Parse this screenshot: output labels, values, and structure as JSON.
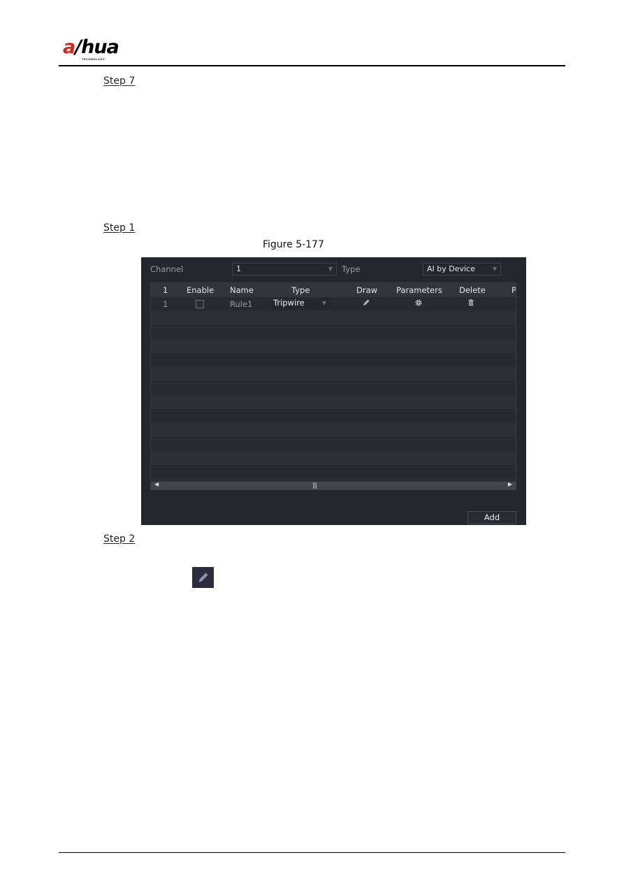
{
  "header": {
    "brand": {
      "main_prefix": "a",
      "main_rest": "hua",
      "separator": "/",
      "sub": "TECHNOLOGY",
      "accent": "#d7261e"
    }
  },
  "document": {
    "steps": [
      "Step 7",
      "Step 1",
      "Step 2"
    ],
    "figure_caption": "Figure 5-177",
    "inline_icon": "pencil-icon"
  },
  "screen": {
    "channel_label": "Channel",
    "channel_value": "1",
    "type_label": "Type",
    "type_value": "AI by Device",
    "table": {
      "headers": [
        "1",
        "Enable",
        "Name",
        "Type",
        "Draw",
        "Parameters",
        "Delete",
        "P"
      ],
      "rows": [
        {
          "index": "1",
          "enabled": false,
          "name": "Rule1",
          "type": "Tripwire",
          "draw_icon": "pencil-icon",
          "params_icon": "gear-icon",
          "delete_icon": "trash-icon"
        }
      ],
      "empty_rows": 13
    },
    "add_button": "Add",
    "colors": {
      "background": "#26272c",
      "header": "#34353c",
      "row_even": "#2e2f36",
      "row_odd": "#292a30"
    }
  }
}
